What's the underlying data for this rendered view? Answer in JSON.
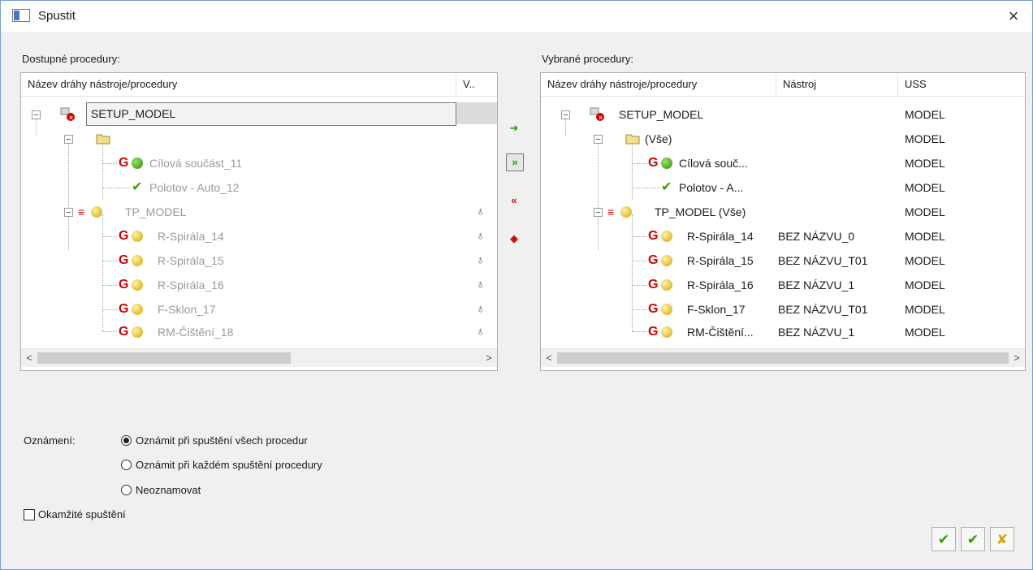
{
  "window": {
    "title": "Spustit",
    "close": "×"
  },
  "left": {
    "label": "Dostupné procedury:",
    "columns": [
      "Název dráhy nástroje/procedury",
      "V.."
    ],
    "rows": [
      {
        "text": "SETUP_MODEL"
      },
      {
        "text": ""
      },
      {
        "text": "Cílová součást_11"
      },
      {
        "text": "Polotov - Auto_12"
      },
      {
        "text": "TP_MODEL"
      },
      {
        "text": "R-Spirála_14"
      },
      {
        "text": "R-Spirála_15"
      },
      {
        "text": "R-Spirála_16"
      },
      {
        "text": "F-Sklon_17"
      },
      {
        "text": "RM-Čištění_18"
      }
    ]
  },
  "right": {
    "label": "Vybrané procedury:",
    "columns": [
      "Název dráhy nástroje/procedury",
      "Nástroj",
      "USS"
    ],
    "rows": [
      {
        "name": "SETUP_MODEL",
        "tool": "",
        "uss": "MODEL"
      },
      {
        "name": "(Vše)",
        "tool": "",
        "uss": "MODEL"
      },
      {
        "name": "Cílová souč...",
        "tool": "",
        "uss": "MODEL"
      },
      {
        "name": "Polotov - A...",
        "tool": "",
        "uss": "MODEL"
      },
      {
        "name": "TP_MODEL (Vše)",
        "tool": "",
        "uss": "MODEL"
      },
      {
        "name": "R-Spirála_14",
        "tool": "BEZ NÁZVU_0",
        "uss": "MODEL"
      },
      {
        "name": "R-Spirála_15",
        "tool": "BEZ NÁZVU_T01",
        "uss": "MODEL"
      },
      {
        "name": "R-Spirála_16",
        "tool": "BEZ NÁZVU_1",
        "uss": "MODEL"
      },
      {
        "name": "F-Sklon_17",
        "tool": "BEZ NÁZVU_T01",
        "uss": "MODEL"
      },
      {
        "name": "RM-Čištění...",
        "tool": "BEZ NÁZVU_1",
        "uss": "MODEL"
      }
    ]
  },
  "notify": {
    "label": "Oznámení:",
    "options": [
      "Oznámit při spuštění všech procedur",
      "Oznámit při každém spuštění procedury",
      "Neoznamovat"
    ],
    "selected_index": 0
  },
  "immediate": {
    "label": "Okamžité spuštění",
    "checked": false
  },
  "scroll": {
    "left": "<",
    "right": ">"
  },
  "icons": {
    "move_right": "arrow-right-icon",
    "move_all_right": "double-arrow-right-icon",
    "move_all_left": "double-arrow-left-icon",
    "move_left": "arrow-left-icon",
    "bottom": [
      "check-bulb-icon",
      "check-icon",
      "cancel-icon"
    ]
  },
  "colors": {
    "accent_red": "#d40000",
    "green": "#2d8f00",
    "border": "#adadad"
  }
}
